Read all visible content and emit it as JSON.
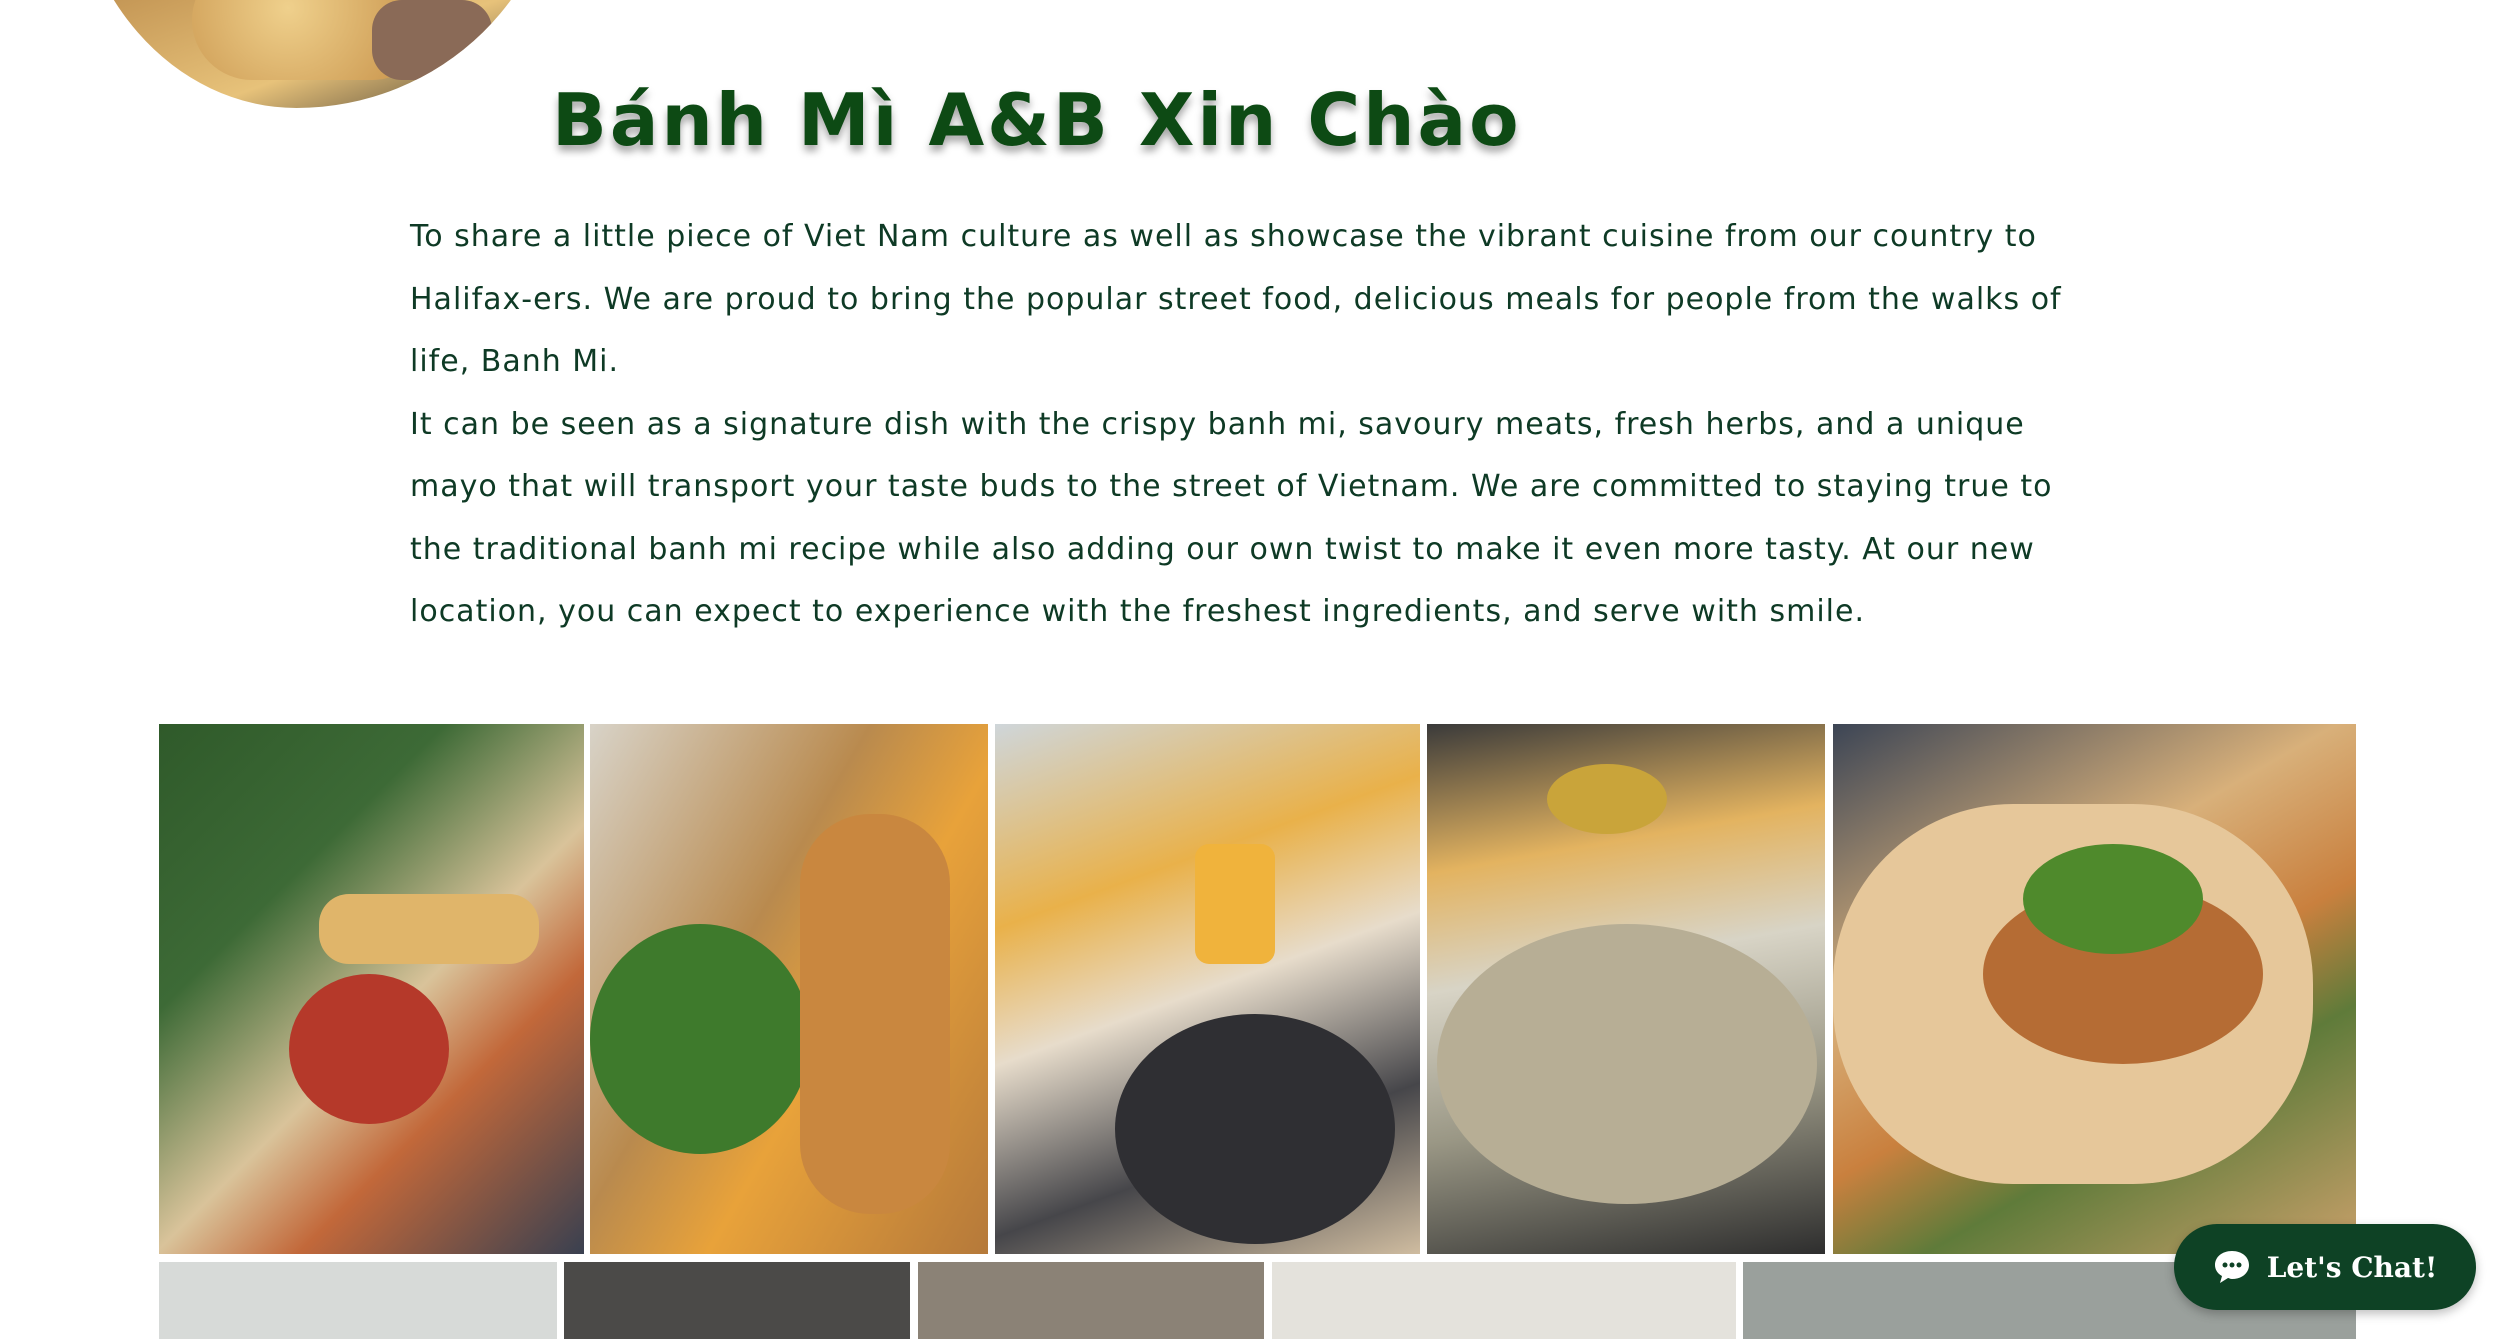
{
  "header": {
    "title": "Bánh Mì A&B Xin Chào"
  },
  "intro": {
    "paragraph1": "To share a little piece of Viet Nam culture as well as showcase the vibrant cuisine from our country to Halifax-ers. We are proud to bring the popular street food, delicious meals for people from the walks of life, Banh Mi.",
    "paragraph2": "It can be seen as a signature dish with the crispy banh mi, savoury meats, fresh herbs, and a unique mayo that will transport your taste buds to the street of Vietnam. We are committed to staying true to the traditional banh mi recipe while also adding our own twist to make it even more tasty. At our new location, you can expect to experience with the freshest ingredients, and serve with smile."
  },
  "chat": {
    "label": "Let's Chat!"
  },
  "colors": {
    "title": "#0d4a14",
    "body_text": "#0e3a25",
    "chat_button": "#0e4225"
  },
  "gallery": {
    "row1": [
      "banh-mi-set-with-soup",
      "grilled-beef-banh-mi-with-salad",
      "breakfast-pan-with-eggs-and-drink",
      "pho-with-bread-and-curry",
      "grilled-chicken-banh-mi"
    ],
    "row2_count_visible": 5
  }
}
